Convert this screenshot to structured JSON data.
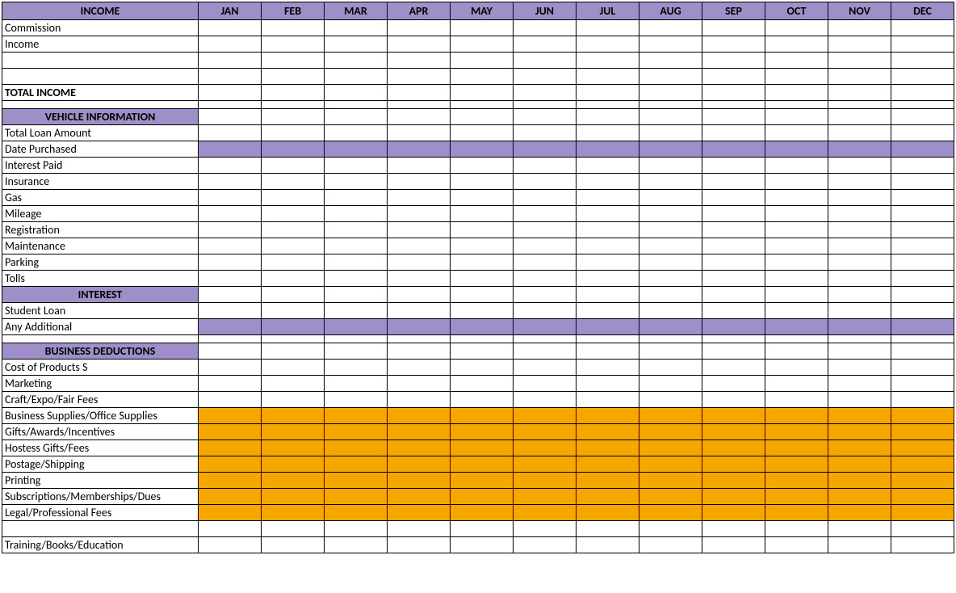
{
  "headers": {
    "main": "INCOME",
    "months": [
      "JAN",
      "FEB",
      "MAR",
      "APR",
      "MAY",
      "JUN",
      "JUL",
      "AUG",
      "SEP",
      "OCT",
      "NOV",
      "DEC"
    ]
  },
  "sections": {
    "income": {
      "rows": [
        "Commission",
        "Income",
        "",
        "",
        "TOTAL INCOME"
      ],
      "bold": [
        4
      ]
    },
    "vehicle": {
      "title": "VEHICLE INFORMATION",
      "rows": [
        "Total Loan Amount",
        "Date Purchased",
        "Interest Paid",
        "Insurance",
        "Gas",
        "Mileage",
        "Registration",
        "Maintenance",
        "Parking",
        "Tolls"
      ],
      "shadedPurple": [
        1
      ]
    },
    "interest": {
      "title": "INTEREST",
      "rows": [
        "Student Loan",
        "Any Additional"
      ],
      "shadedPurple": [
        1
      ]
    },
    "deductions": {
      "title": "BUSINESS DEDUCTIONS",
      "rows": [
        "Cost of Products S",
        "Marketing",
        "Craft/Expo/Fair Fees",
        "Business Supplies/Office Supplies",
        "Gifts/Awards/Incentives",
        "Hostess Gifts/Fees",
        "Postage/Shipping",
        "Printing",
        "Subscriptions/Memberships/Dues",
        "Legal/Professional Fees",
        "",
        "Training/Books/Education"
      ],
      "shadedGold": [
        3,
        4,
        5,
        6,
        7,
        8,
        9
      ]
    }
  }
}
